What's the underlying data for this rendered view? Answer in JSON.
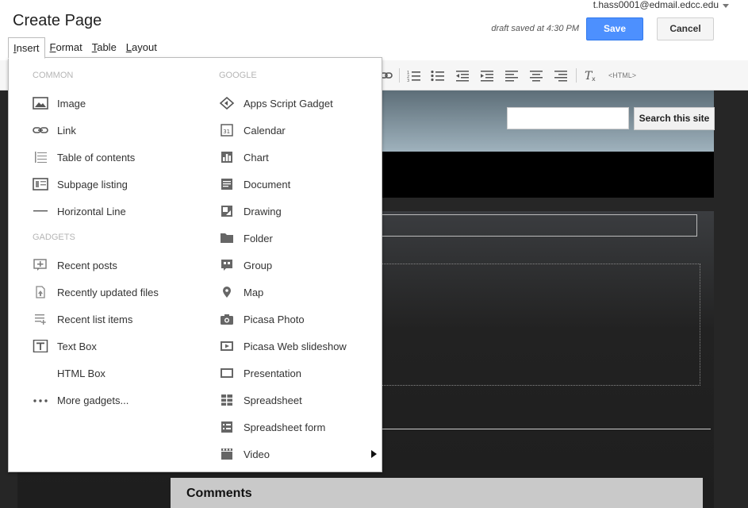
{
  "header": {
    "title": "Create Page",
    "user_email": "t.hass0001@edmail.edcc.edu",
    "draft_status": "draft saved at 4:30 PM",
    "save_label": "Save",
    "cancel_label": "Cancel"
  },
  "menubar": [
    {
      "label": "Insert",
      "key": "I",
      "rest": "nsert"
    },
    {
      "label": "Format",
      "key": "F",
      "rest": "ormat"
    },
    {
      "label": "Table",
      "key": "T",
      "rest": "able"
    },
    {
      "label": "Layout",
      "key": "L",
      "rest": "ayout"
    }
  ],
  "toolbar": {
    "html_label": "<HTML>",
    "icons": [
      "link-icon",
      "numbered-list-icon",
      "bulleted-list-icon",
      "indent-less-icon",
      "indent-more-icon",
      "align-left-icon",
      "align-center-icon",
      "align-right-icon",
      "remove-formatting-icon"
    ]
  },
  "insert_menu": {
    "common": {
      "header": "COMMON",
      "items": [
        {
          "label": "Image",
          "icon": "image-icon"
        },
        {
          "label": "Link",
          "icon": "link-icon"
        },
        {
          "label": "Table of contents",
          "icon": "table-of-contents-icon"
        },
        {
          "label": "Subpage listing",
          "icon": "subpage-listing-icon"
        },
        {
          "label": "Horizontal Line",
          "icon": "horizontal-line-icon"
        }
      ]
    },
    "gadgets": {
      "header": "GADGETS",
      "items": [
        {
          "label": "Recent posts",
          "icon": "recent-posts-icon"
        },
        {
          "label": "Recently updated files",
          "icon": "recently-updated-files-icon"
        },
        {
          "label": "Recent list items",
          "icon": "recent-list-items-icon"
        },
        {
          "label": "Text Box",
          "icon": "text-box-icon"
        },
        {
          "label": "HTML Box",
          "icon": ""
        },
        {
          "label": "More gadgets...",
          "icon": "more-icon"
        }
      ]
    },
    "google": {
      "header": "GOOGLE",
      "items": [
        {
          "label": "Apps Script Gadget",
          "icon": "apps-script-icon"
        },
        {
          "label": "Calendar",
          "icon": "calendar-icon"
        },
        {
          "label": "Chart",
          "icon": "chart-icon"
        },
        {
          "label": "Document",
          "icon": "document-icon"
        },
        {
          "label": "Drawing",
          "icon": "drawing-icon"
        },
        {
          "label": "Folder",
          "icon": "folder-icon"
        },
        {
          "label": "Group",
          "icon": "group-icon"
        },
        {
          "label": "Map",
          "icon": "map-pin-icon"
        },
        {
          "label": "Picasa Photo",
          "icon": "camera-icon"
        },
        {
          "label": "Picasa Web slideshow",
          "icon": "slideshow-icon"
        },
        {
          "label": "Presentation",
          "icon": "presentation-icon"
        },
        {
          "label": "Spreadsheet",
          "icon": "spreadsheet-icon"
        },
        {
          "label": "Spreadsheet form",
          "icon": "spreadsheet-form-icon"
        },
        {
          "label": "Video",
          "icon": "video-icon"
        }
      ]
    }
  },
  "site": {
    "search_button_label": "Search this site",
    "comments_label": "Comments"
  },
  "colors": {
    "accent": "#4d90fe",
    "canvas_bg": "#262626",
    "header_band": "#8fa2ad"
  }
}
